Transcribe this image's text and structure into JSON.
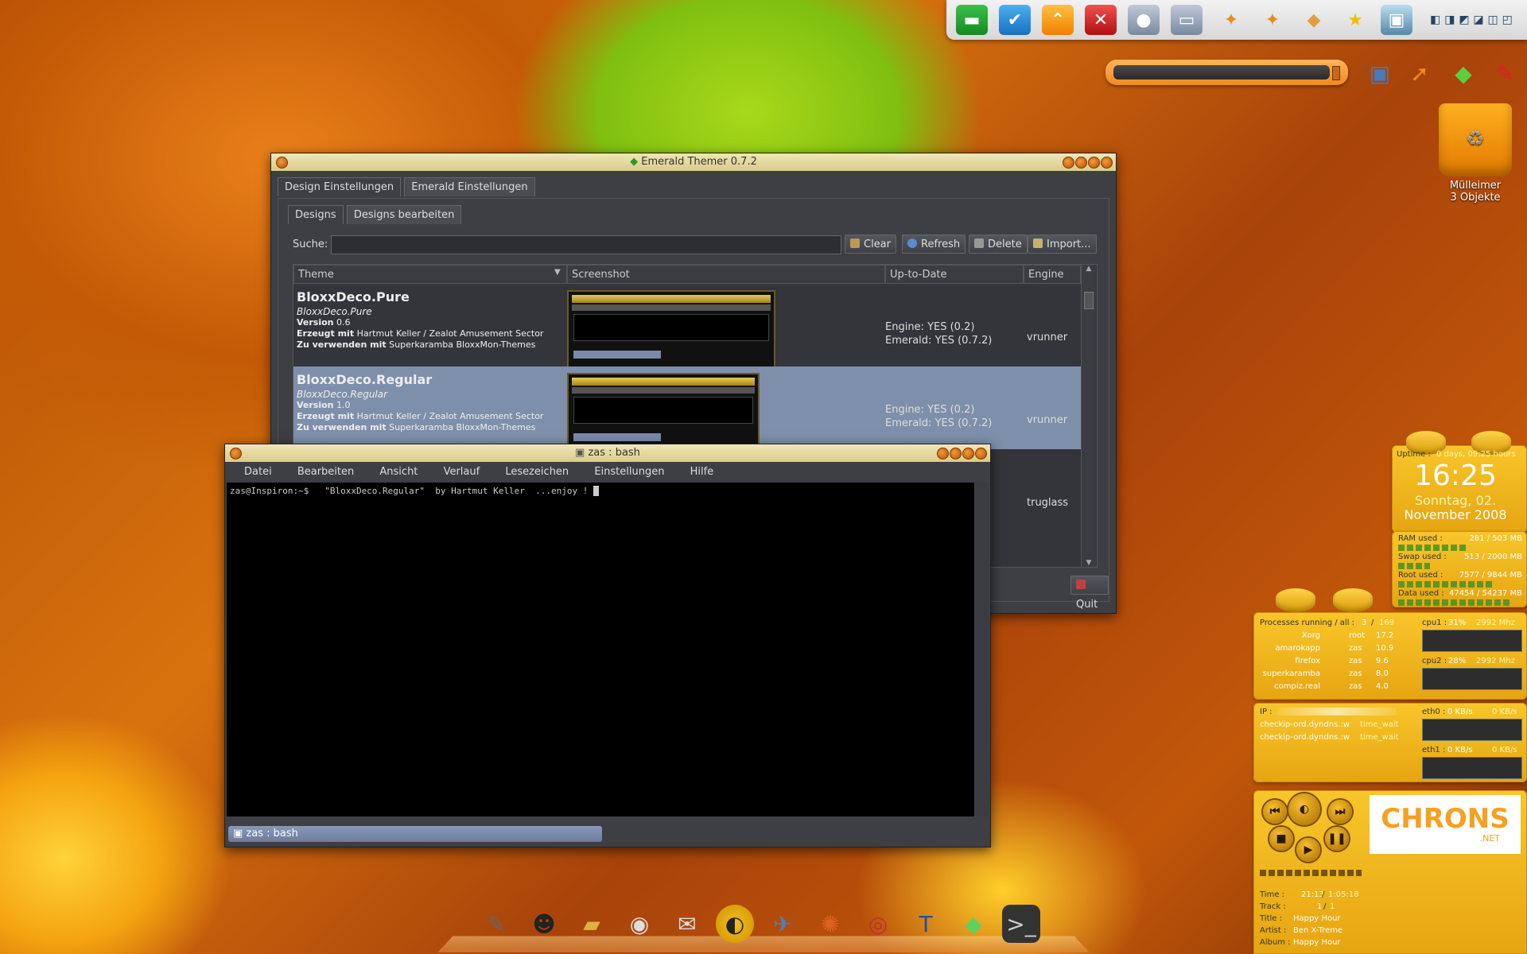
{
  "emerald": {
    "title": "Emerald Themer 0.7.2",
    "tabs": [
      "Design Einstellungen",
      "Emerald Einstellungen"
    ],
    "subtabs": [
      "Designs",
      "Designs bearbeiten"
    ],
    "search_label": "Suche:",
    "search_value": "",
    "buttons": {
      "clear": "Clear",
      "refresh": "Refresh",
      "delete": "Delete",
      "import": "Import...",
      "quit": "Quit"
    },
    "columns": [
      "Theme",
      "Screenshot",
      "Up-to-Date",
      "Engine"
    ],
    "rows": [
      {
        "name": "BloxxDeco.Pure",
        "subtitle": "BloxxDeco.Pure",
        "version_label": "Version",
        "version": "0.6",
        "author_label": "Erzeugt mit",
        "author": "Hartmut Keller / Zealot Amusement Sector",
        "use_label": "Zu verwenden mit",
        "use": "Superkaramba BloxxMon-Themes",
        "engine_status": "Engine: YES (0.2)",
        "emerald_status": "Emerald: YES (0.7.2)",
        "engine": "vrunner"
      },
      {
        "name": "BloxxDeco.Regular",
        "subtitle": "BloxxDeco.Regular",
        "version_label": "Version",
        "version": "1.0",
        "author_label": "Erzeugt mit",
        "author": "Hartmut Keller / Zealot Amusement Sector",
        "use_label": "Zu verwenden mit",
        "use": "Superkaramba BloxxMon-Themes",
        "engine_status": "Engine: YES (0.2)",
        "emerald_status": "Emerald: YES (0.7.2)",
        "engine": "vrunner"
      },
      {
        "engine": "truglass"
      }
    ]
  },
  "terminal": {
    "title": "zas : bash",
    "menu": [
      "Datei",
      "Bearbeiten",
      "Ansicht",
      "Verlauf",
      "Lesezeichen",
      "Einstellungen",
      "Hilfe"
    ],
    "prompt_line": "zas@Inspiron:~$   \"BloxxDeco.Regular\"  by Hartmut Keller  ...enjoy ! ",
    "tab_label": "zas : bash"
  },
  "trash": {
    "label": "Mülleimer",
    "count": "3 Objekte"
  },
  "widgets": {
    "uptime_label": "Uptime :",
    "uptime_value": "0 days, 09:25 hours",
    "clock": "16:25",
    "date_line1": "Sonntag, 02.",
    "date_line2": "November 2008",
    "mem": [
      {
        "label": "RAM used :",
        "value": "281 / 503 MB"
      },
      {
        "label": "Swap used :",
        "value": "513 / 2000 MB"
      },
      {
        "label": "Root used :",
        "value": "7577 / 9844 MB"
      },
      {
        "label": "Data used :",
        "value": "47454 / 54237 MB"
      }
    ],
    "proc_label": "Processes running / all :",
    "proc_running": "3",
    "proc_all": "169",
    "processes": [
      {
        "name": "Xorg",
        "user": "root",
        "cpu": "17.2"
      },
      {
        "name": "amarokapp",
        "user": "zas",
        "cpu": "10.9"
      },
      {
        "name": "firefox",
        "user": "zas",
        "cpu": "9.6"
      },
      {
        "name": "superkaramba",
        "user": "zas",
        "cpu": "8.0"
      },
      {
        "name": "compiz.real",
        "user": "zas",
        "cpu": "4.0"
      }
    ],
    "cpu1": {
      "label": "cpu1 :",
      "pct": "31%",
      "mhz": "2992 Mhz"
    },
    "cpu2": {
      "label": "cpu2 :",
      "pct": "28%",
      "mhz": "2992 Mhz"
    },
    "ip_label": "IP :",
    "connections": [
      {
        "host": "checkip-ord.dyndns.:w",
        "state": "time_wait"
      },
      {
        "host": "checkip-ord.dyndns.:w",
        "state": "time_wait"
      }
    ],
    "eth0": {
      "label": "eth0 :",
      "down": "0 KB/s",
      "up": "0 KB/s"
    },
    "eth1": {
      "label": "eth1 :",
      "down": "0 KB/s",
      "up": "0 KB/s"
    },
    "player": {
      "logo": "CHRONS",
      "logo_sub": ".NET",
      "time_label": "Time :",
      "time": "21:13",
      "time_total": "1:05:18",
      "track_label": "Track :",
      "track": "1",
      "track_total": "1",
      "title_label": "Title :",
      "title": "Happy Hour",
      "artist_label": "Artist :",
      "artist": "Ben X-Treme",
      "album_label": "Album :",
      "album": "Happy Hour"
    }
  },
  "colors": {
    "accent": "#f5b21a",
    "selected_row": "#7e8fab"
  }
}
